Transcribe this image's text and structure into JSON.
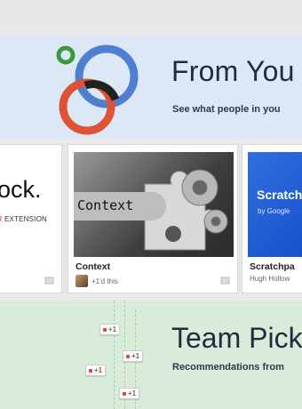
{
  "from_your_circles": {
    "title": "From You",
    "subtitle": "See what people in you"
  },
  "cards": [
    {
      "big_text": "lock.",
      "ext_prefix": "AR",
      "ext_suffix": " EXTENSION"
    },
    {
      "thumb_text": "Context",
      "title": "Context",
      "meta": "+1'd this"
    },
    {
      "thumb_title": "Scratch",
      "thumb_sub": "by Google",
      "title": "Scratchpa",
      "meta": "Hugh Hollow"
    }
  ],
  "team_picks": {
    "title": "Team Pick",
    "subtitle": "Recommendations from",
    "plus_one_label": "+1"
  },
  "colors": {
    "banner_blue": "#dce8f6",
    "banner_green": "#d9ecd9",
    "ring_blue": "#4f7fd0",
    "ring_red": "#de5336",
    "ring_dark": "#222222",
    "ring_green": "#3a9a3a",
    "scratchpad_blue": "#2f6fe0"
  }
}
